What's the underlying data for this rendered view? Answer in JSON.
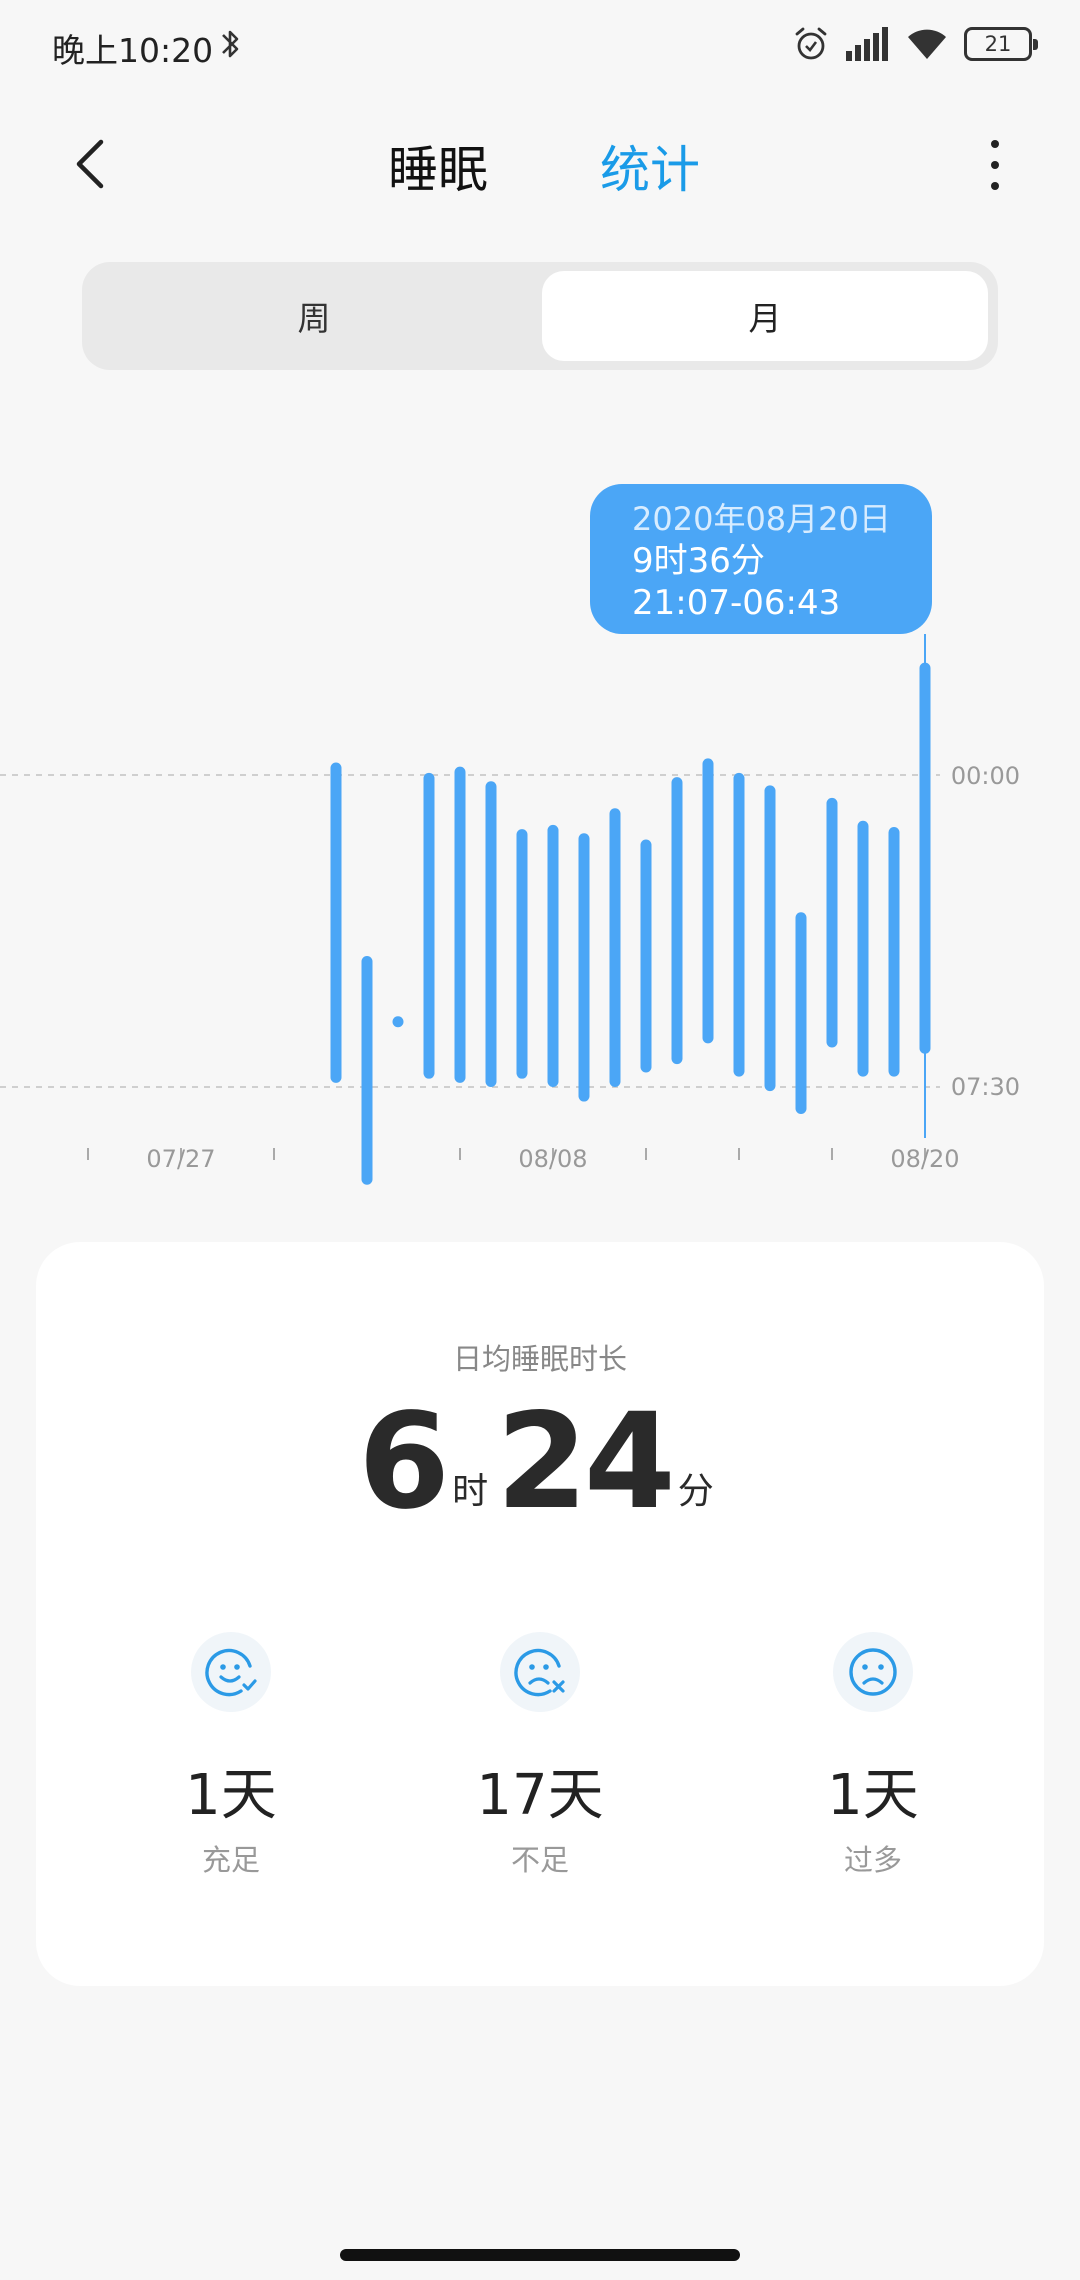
{
  "status_bar": {
    "time": "晚上10:20",
    "battery": "21",
    "icons": [
      "bluetooth-icon",
      "alarm-icon",
      "signal-icon",
      "wifi-icon",
      "battery-icon"
    ]
  },
  "header": {
    "back_icon": "chevron-left-icon",
    "tabs": [
      {
        "label": "睡眠",
        "active": false
      },
      {
        "label": "统计",
        "active": true
      }
    ],
    "more_icon": "more-vertical-icon",
    "accent_color": "#1a9be8"
  },
  "segment": {
    "options": [
      "周",
      "月"
    ],
    "selected": "月"
  },
  "chart_data": {
    "type": "bar",
    "title": "",
    "y_labels": [
      "00:00",
      "07:30"
    ],
    "x_labels": [
      "07/27",
      "08/08",
      "08/20"
    ],
    "bar_color": "#4ba6f6",
    "selected_index": 19,
    "bars": [
      {
        "start": -0.3,
        "end": 7.4
      },
      {
        "start": 4.35,
        "end": 9.85
      },
      {
        "start": 5.9,
        "end": 5.8
      },
      {
        "start": -0.05,
        "end": 7.3
      },
      {
        "start": -0.2,
        "end": 7.4
      },
      {
        "start": 0.15,
        "end": 7.5
      },
      {
        "start": 1.3,
        "end": 7.3
      },
      {
        "start": 1.2,
        "end": 7.5
      },
      {
        "start": 1.4,
        "end": 7.85
      },
      {
        "start": 0.8,
        "end": 7.5
      },
      {
        "start": 1.55,
        "end": 7.15
      },
      {
        "start": 0.05,
        "end": 6.95
      },
      {
        "start": -0.4,
        "end": 6.45
      },
      {
        "start": -0.05,
        "end": 7.25
      },
      {
        "start": 0.25,
        "end": 7.6
      },
      {
        "start": 3.3,
        "end": 8.15
      },
      {
        "start": 0.55,
        "end": 6.55
      },
      {
        "start": 1.1,
        "end": 7.25
      },
      {
        "start": 1.25,
        "end": 7.25
      },
      {
        "start": -2.7,
        "end": 6.7
      }
    ],
    "tooltip": {
      "date": "2020年08月20日",
      "duration": "9时36分",
      "range": "21:07-06:43"
    }
  },
  "summary": {
    "title": "日均睡眠时长",
    "hours": "6",
    "hours_unit": "时",
    "minutes": "24",
    "minutes_unit": "分",
    "stats": [
      {
        "icon": "smile-check-icon",
        "value": "1天",
        "label": "充足"
      },
      {
        "icon": "sad-x-icon",
        "value": "17天",
        "label": "不足"
      },
      {
        "icon": "sad-face-icon",
        "value": "1天",
        "label": "过多"
      }
    ],
    "icon_color": "#2b9ae6"
  }
}
